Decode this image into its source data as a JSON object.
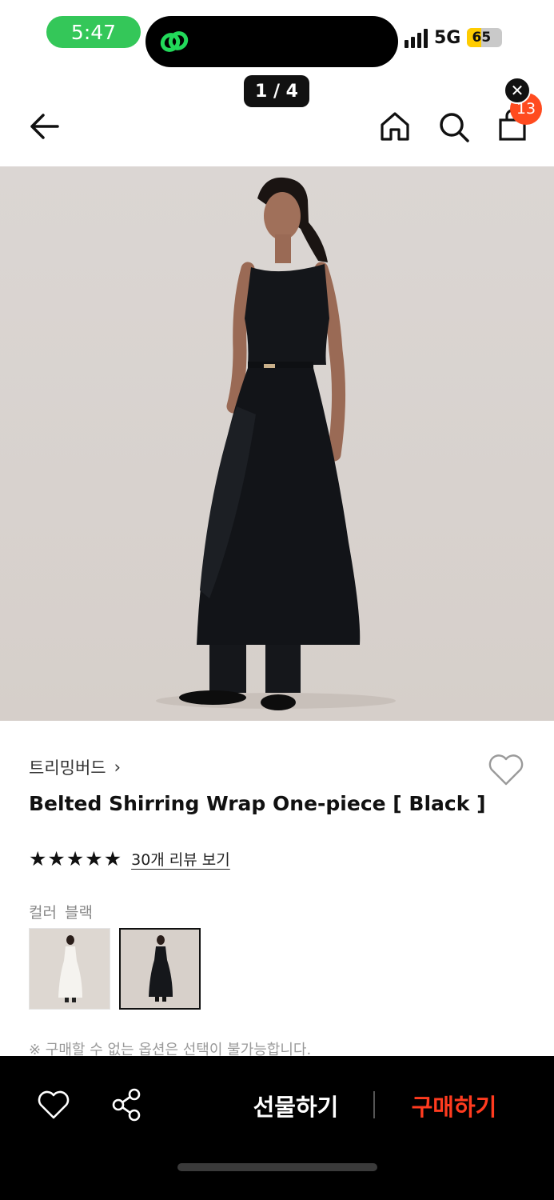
{
  "status_bar": {
    "time": "5:47",
    "network": "5G",
    "battery": "65"
  },
  "gallery": {
    "counter": "1 / 4"
  },
  "header": {
    "cart_count": "13",
    "close_symbol": "✕"
  },
  "product": {
    "brand": "트리밍버드",
    "brand_chevron": "›",
    "title": "Belted Shirring Wrap One-piece [ Black ]",
    "rating_stars": 5,
    "star_symbol": "★",
    "review_link": "30개 리뷰 보기",
    "color_label": "컬러",
    "color_value": "블랙",
    "notice": "※ 구매할 수 없는 옵션은 선택이 불가능합니다."
  },
  "bottom_bar": {
    "gift_label": "선물하기",
    "buy_label": "구매하기"
  },
  "icons": [
    "back-arrow-icon",
    "home-icon",
    "search-icon",
    "shopping-bag-icon",
    "heart-icon",
    "share-icon",
    "close-icon"
  ],
  "colors": {
    "accent": "#ff3b1f",
    "badge": "#ff4b1f",
    "status_green": "#34c759",
    "bottom_bar_bg": "#000000"
  }
}
